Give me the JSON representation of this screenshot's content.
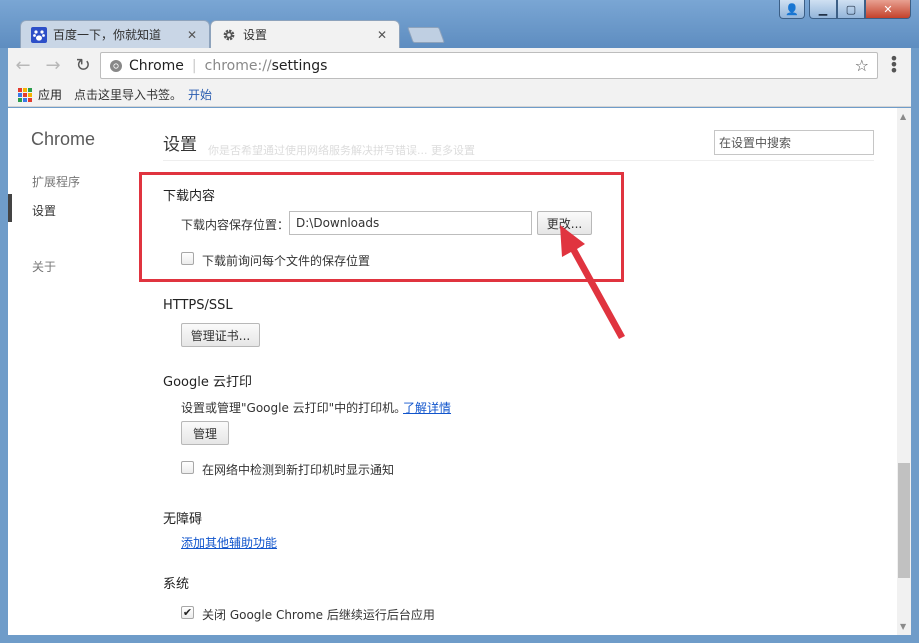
{
  "tabs": [
    {
      "title": "百度一下，你就知道",
      "close": "✕"
    },
    {
      "title": "设置",
      "close": "✕"
    }
  ],
  "toolbar": {
    "back": "←",
    "forward": "→",
    "reload": "↻",
    "omnibox_label": "Chrome",
    "url_scheme": "chrome://",
    "url_path": "settings",
    "star": "☆",
    "menu": "⋮"
  },
  "bookmarks": {
    "apps_label": "应用",
    "hint": "点击这里导入书签。",
    "start_link": "开始",
    "apps_colors": [
      "#e33b2e",
      "#f5b400",
      "#2a9d4b",
      "#3b78e7",
      "#e33b2e",
      "#f5b400",
      "#2a9d4b",
      "#3b78e7",
      "#e33b2e"
    ]
  },
  "sidebar": {
    "title": "Chrome",
    "items": [
      {
        "label": "扩展程序"
      },
      {
        "label": "设置"
      },
      {
        "label": "关于"
      }
    ]
  },
  "main": {
    "page_title": "设置",
    "faded_text": "你是否希望通过使用网络服务解决拼写错误...    更多设置",
    "search_placeholder": "在设置中搜索",
    "downloads": {
      "title": "下载内容",
      "location_label": "下载内容保存位置：",
      "location_value": "D:\\Downloads",
      "change_button": "更改...",
      "ask_label": "下载前询问每个文件的保存位置"
    },
    "https": {
      "title": "HTTPS/SSL",
      "manage_button": "管理证书..."
    },
    "cloudprint": {
      "title": "Google 云打印",
      "desc": "设置或管理\"Google 云打印\"中的打印机。",
      "learn_more": "了解详情",
      "manage_button": "管理",
      "notify_label": "在网络中检测到新打印机时显示通知"
    },
    "accessibility": {
      "title": "无障碍",
      "link": "添加其他辅助功能"
    },
    "system": {
      "title": "系统",
      "bg_label": "关闭 Google Chrome 后继续运行后台应用",
      "check": "✔"
    }
  },
  "colors": {
    "annotation_red": "#e0343f",
    "link_blue": "#1155cc"
  }
}
